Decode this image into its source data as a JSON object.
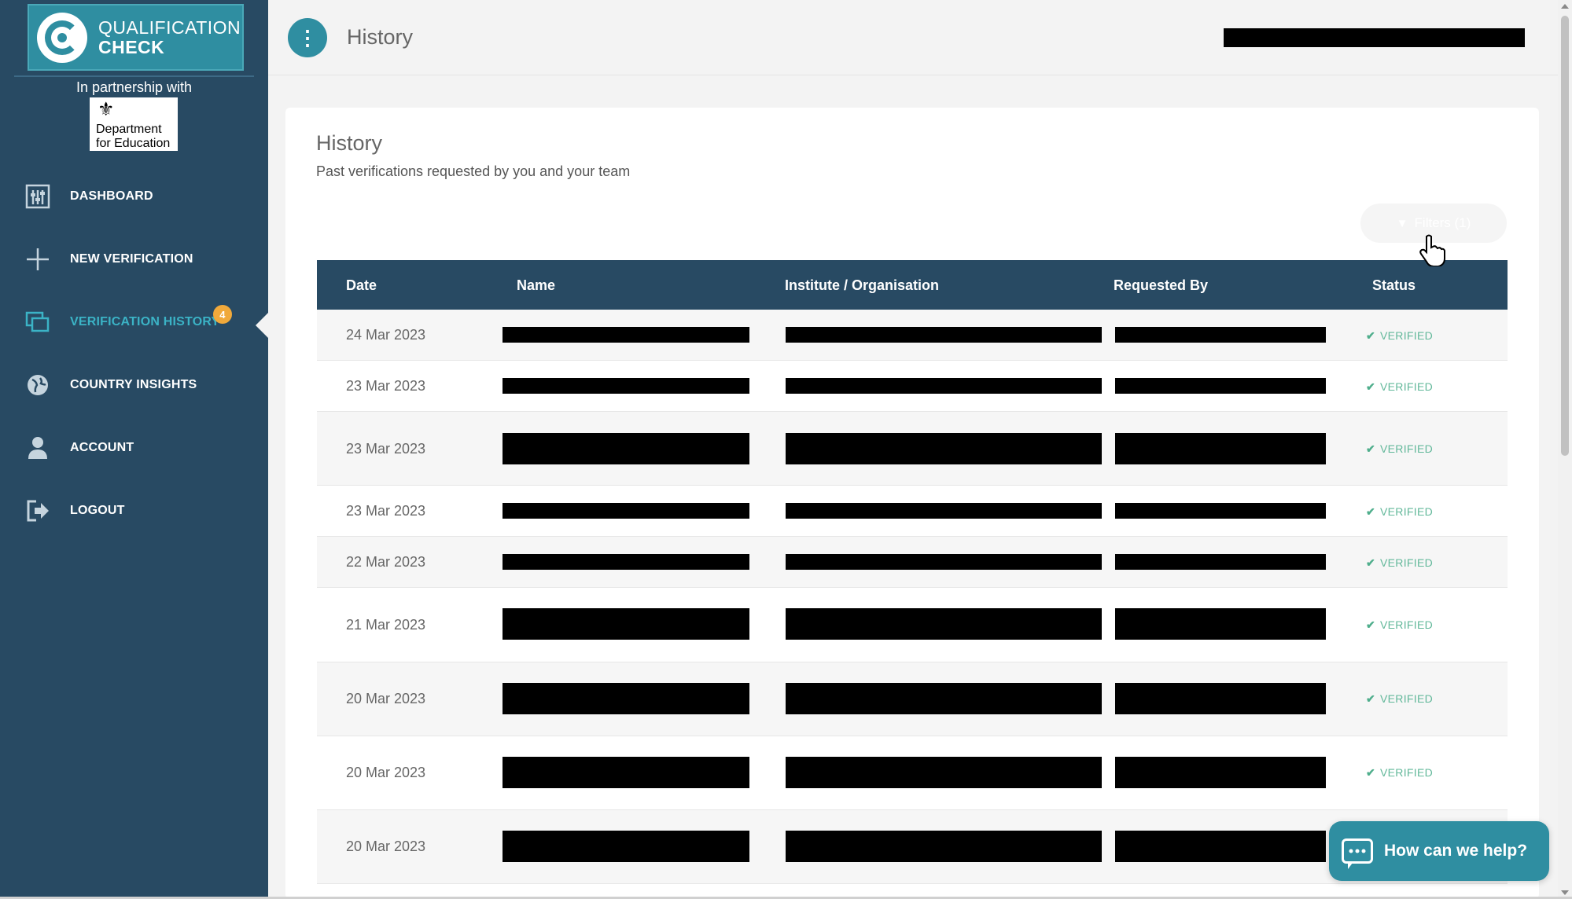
{
  "brand": {
    "line1": "QUALIFICATION",
    "line2": "CHECK"
  },
  "partner": {
    "text": "In partnership with",
    "dfe_line1": "Department",
    "dfe_line2": "for Education"
  },
  "nav": {
    "items": [
      {
        "label": "DASHBOARD",
        "icon": "dashboard-icon"
      },
      {
        "label": "NEW VERIFICATION",
        "icon": "plus-icon"
      },
      {
        "label": "VERIFICATION HISTORY",
        "icon": "history-icon",
        "badge": "4",
        "active": true
      },
      {
        "label": "COUNTRY INSIGHTS",
        "icon": "globe-icon"
      },
      {
        "label": "ACCOUNT",
        "icon": "user-icon"
      },
      {
        "label": "LOGOUT",
        "icon": "logout-icon"
      }
    ]
  },
  "header": {
    "title": "History",
    "menu_icon": "kebab-menu-icon"
  },
  "card": {
    "title": "History",
    "subtitle": "Past verifications requested by you and your team",
    "filters_label": "Filters (1)"
  },
  "table": {
    "columns": [
      "Date",
      "Name",
      "Institute / Organisation",
      "Requested By",
      "Status"
    ],
    "rows": [
      {
        "date": "24 Mar 2023",
        "status": "VERIFIED"
      },
      {
        "date": "23 Mar 2023",
        "status": "VERIFIED"
      },
      {
        "date": "23 Mar 2023",
        "status": "VERIFIED"
      },
      {
        "date": "23 Mar 2023",
        "status": "VERIFIED"
      },
      {
        "date": "22 Mar 2023",
        "status": "VERIFIED"
      },
      {
        "date": "21 Mar 2023",
        "status": "VERIFIED"
      },
      {
        "date": "20 Mar 2023",
        "status": "VERIFIED"
      },
      {
        "date": "20 Mar 2023",
        "status": "VERIFIED"
      },
      {
        "date": "20 Mar 2023",
        "status": ""
      }
    ]
  },
  "chat": {
    "label": "How can we help?"
  },
  "colors": {
    "sidebar": "#284a63",
    "accent": "#2f8ea1",
    "verified": "#62b89a",
    "badge": "#f0a93b"
  }
}
